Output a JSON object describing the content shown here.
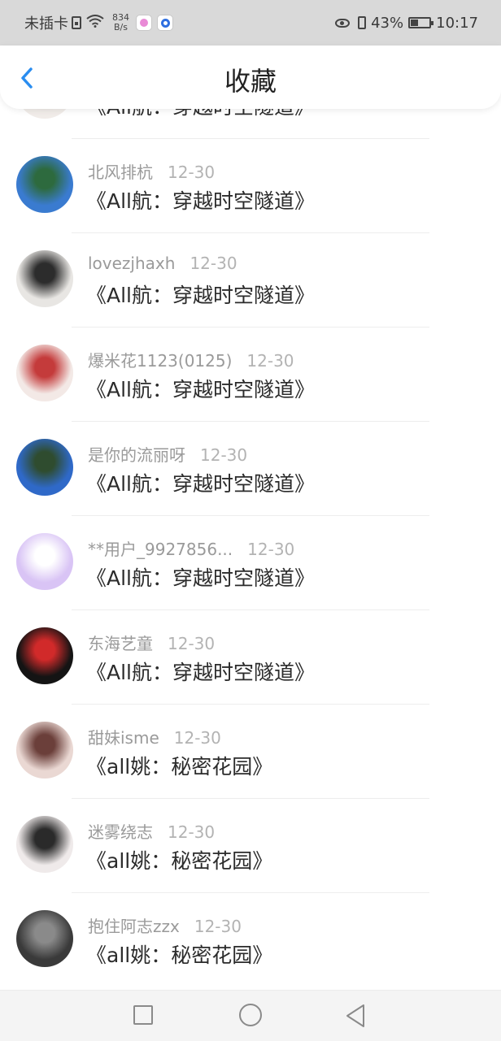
{
  "status_bar": {
    "carrier": "未插卡",
    "net_speed_value": "834",
    "net_speed_unit": "B/s",
    "battery": "43%",
    "time": "10:17",
    "battery_level": 0.43,
    "icons": [
      "sim-icon",
      "wifi-icon",
      "app-badge-pink",
      "app-badge-blue",
      "eye-icon",
      "vibrate-icon",
      "battery-icon"
    ]
  },
  "header": {
    "title": "收藏",
    "back_icon": "chevron-left-icon",
    "accent": "#2a8df0"
  },
  "list": {
    "items": [
      {
        "user": "",
        "date": "",
        "title": "《All航：穿越时空隧道》",
        "avatar_colors": [
          "#f1ece9",
          "#d9d3cf"
        ]
      },
      {
        "user": "北风排杭",
        "date": "12-30",
        "title": "《All航：穿越时空隧道》",
        "avatar_colors": [
          "#3a7bd0",
          "#2d6a3e"
        ]
      },
      {
        "user": "lovezjhaxh",
        "date": "12-30",
        "title": "《All航：穿越时空隧道》",
        "avatar_colors": [
          "#e8e6e3",
          "#2c2c2c"
        ]
      },
      {
        "user": "爆米花1123(0125)",
        "date": "12-30",
        "title": "《All航：穿越时空隧道》",
        "avatar_colors": [
          "#f3e9e6",
          "#c43b3b"
        ]
      },
      {
        "user": "是你的流丽呀",
        "date": "12-30",
        "title": "《All航：穿越时空隧道》",
        "avatar_colors": [
          "#2f69c8",
          "#2f4c2f"
        ]
      },
      {
        "user": "**用户_9927856...",
        "date": "12-30",
        "title": "《All航：穿越时空隧道》",
        "avatar_colors": [
          "#d9c4f5",
          "#ffffff"
        ]
      },
      {
        "user": "东海艺童",
        "date": "12-30",
        "title": "《All航：穿越时空隧道》",
        "avatar_colors": [
          "#141414",
          "#d12a2a"
        ]
      },
      {
        "user": "甜妹isme",
        "date": "12-30",
        "title": "《all姚：秘密花园》",
        "avatar_colors": [
          "#ead8d3",
          "#6b3f3a"
        ]
      },
      {
        "user": "迷雾绕志",
        "date": "12-30",
        "title": "《all姚：秘密花园》",
        "avatar_colors": [
          "#efeaea",
          "#2a2a2a"
        ]
      },
      {
        "user": "抱住阿志zzx",
        "date": "12-30",
        "title": "《all姚：秘密花园》",
        "avatar_colors": [
          "#3a3a3a",
          "#8a8a8a"
        ]
      }
    ]
  },
  "nav_bar": {
    "icons": [
      "recent-apps-icon",
      "home-icon",
      "back-triangle-icon"
    ]
  }
}
